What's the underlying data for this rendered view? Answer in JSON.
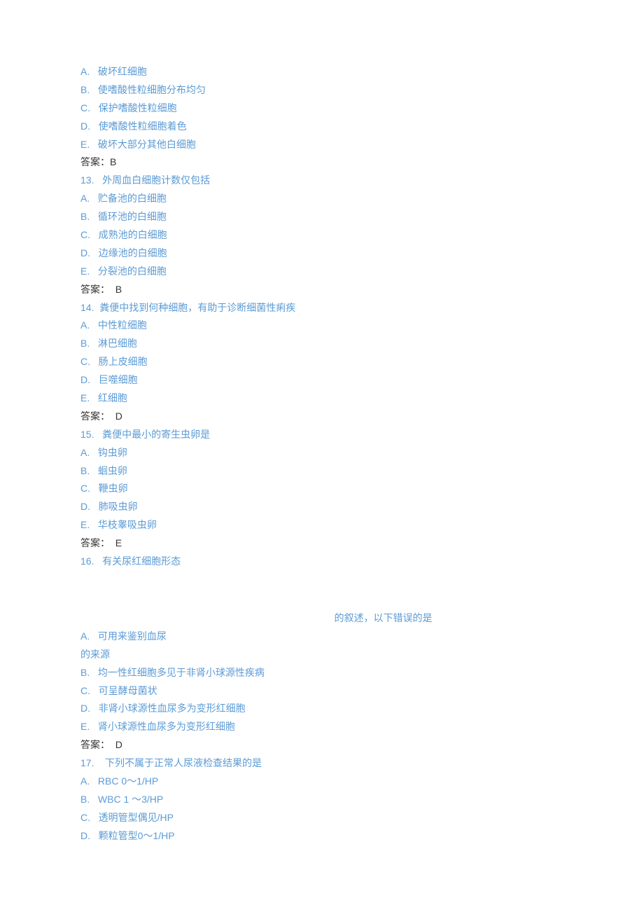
{
  "q12": {
    "options": [
      "A.   破坏红细胞",
      "B.   使嗜酸性粒细胞分布均匀",
      "C.   保护嗜酸性粒细胞",
      "D.   使嗜酸性粒细胞着色",
      "E.   破坏大部分其他白细胞"
    ],
    "answer": "答案：B"
  },
  "q13": {
    "stem": "13.   外周血白细胞计数仅包括",
    "options": [
      "A.   贮备池的白细胞",
      "B.   循环池的白细胞",
      "C.   成熟池的白细胞",
      "D.   边缘池的白细胞",
      "E.   分裂池的白细胞"
    ],
    "answer": "答案：  B"
  },
  "q14": {
    "stem": "14.  粪便中找到何种细胞，有助于诊断细菌性痢疾",
    "options": [
      "A.   中性粒细胞",
      "B.   淋巴细胞",
      "C.   肠上皮细胞",
      "D.   巨噬细胞",
      "E.   红细胞"
    ],
    "answer": "答案：  D"
  },
  "q15": {
    "stem": "15.   粪便中最小的寄生虫卵是",
    "options": [
      "A.   钩虫卵",
      "B.   蛔虫卵",
      "C.   鞭虫卵",
      "D.   肺吸虫卵",
      "E.   华枝睾吸虫卵"
    ],
    "answer": "答案：  E"
  },
  "q16": {
    "stem_part1": "16.   有关尿红细胞形态",
    "stem_part2": "的叙述，以下错误的是",
    "optA_line1": "A.   可用来鉴别血尿",
    "optA_line2": "的来源",
    "options_rest": [
      "B.   均一性红细胞多见于非肾小球源性疾病",
      "C.   可呈酵母菌状",
      "D.   非肾小球源性血尿多为变形红细胞",
      "E.   肾小球源性血尿多为变形红细胞"
    ],
    "answer": "答案：  D"
  },
  "q17": {
    "stem": "17.    下列不属于正常人尿液检查结果的是",
    "options": [
      "A.   RBC 0～1/HP",
      "B.   WBC 1 ～3/HP",
      "C.   透明管型偶见/HP",
      "D.   颗粒管型0～1/HP"
    ]
  }
}
